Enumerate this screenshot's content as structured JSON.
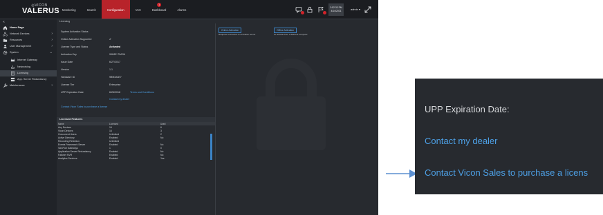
{
  "app": {
    "brand_small": "◎VICON",
    "brand": "VALERUS",
    "nav_tabs": [
      {
        "label": "Monitoring"
      },
      {
        "label": "Search"
      },
      {
        "label": "Configuration",
        "active": true
      },
      {
        "label": "VAX"
      },
      {
        "label": "Dashboard",
        "badge": "1"
      },
      {
        "label": "Alarms"
      }
    ],
    "clock_time": "3:52:33 PM",
    "clock_date": "4/14/2021",
    "user": "admin ▾"
  },
  "sidebar": {
    "collapse": "«",
    "items": [
      {
        "label": "Home Page",
        "icon": "home-icon"
      },
      {
        "label": "Network Devices",
        "icon": "network-icon",
        "arrow": "›"
      },
      {
        "label": "Resources",
        "icon": "folder-icon",
        "arrow": "›"
      },
      {
        "label": "User Management",
        "icon": "user-icon",
        "arrow": "›"
      },
      {
        "label": "System",
        "icon": "gear-icon",
        "arrow": "⌄"
      },
      {
        "label": "Internet Gateway",
        "icon": "gateway-icon"
      },
      {
        "label": "Networking",
        "icon": "networking-icon"
      },
      {
        "label": "Licensing",
        "icon": "license-icon"
      },
      {
        "label": "App. Server Redundancy",
        "icon": "server-icon"
      },
      {
        "label": "Maintenance",
        "icon": "wrench-icon",
        "arrow": "›"
      }
    ]
  },
  "content": {
    "breadcrumb": "Licensing",
    "rows": [
      {
        "key": "System Activation Status",
        "value": ""
      },
      {
        "key": "Online Activation Supported",
        "value": "✔"
      },
      {
        "key": "License Type and Status",
        "value": "Activated"
      },
      {
        "key": "Activation Key",
        "value": "99K8E-T9A3U"
      },
      {
        "key": "Issue Date",
        "value": "6/27/2017"
      },
      {
        "key": "Version",
        "value": "1.1"
      },
      {
        "key": "Hardware ID",
        "value": "9B9DA3E7"
      },
      {
        "key": "License Tier",
        "value": "Enterprise"
      },
      {
        "key": "UPP Expiration Date",
        "value": "6/26/2018",
        "link": "Terms and Conditions"
      }
    ],
    "contact_dealer": "Contact my dealer",
    "contact_sales": "Contact Vicon Sales to purchase a license",
    "features_title": "Licensed Features",
    "features_cols": [
      "Name",
      "Licensed",
      "Used"
    ],
    "features": [
      [
        "Any Devices",
        "16",
        "6"
      ],
      [
        "Vicon Devices",
        "16",
        "3"
      ],
      [
        "Concurrent Users",
        "Unlimited",
        "2"
      ],
      [
        "Active Directory",
        "Enabled",
        "No"
      ],
      [
        "Recording Retention",
        "Unlimited",
        ""
      ],
      [
        "Events Framework Server",
        "Enabled",
        "No"
      ],
      [
        "VAXPort Gateways",
        "1",
        "0"
      ],
      [
        "Application Server Redundancy",
        "Enabled",
        "No"
      ],
      [
        "Failover NVR",
        "Enabled",
        "No"
      ],
      [
        "Analytics Services",
        "Enabled",
        "Yes"
      ]
    ],
    "online_btn": "Online Activation",
    "offline_btn": "Offline Activation",
    "online_hint": "Requires connection to activation server",
    "offline_hint": "To activate from a different computer"
  },
  "zoom": {
    "line1": "UPP Expiration Date:",
    "line2": "Contact my dealer",
    "line3": "Contact Vicon Sales to purchase a licens"
  }
}
